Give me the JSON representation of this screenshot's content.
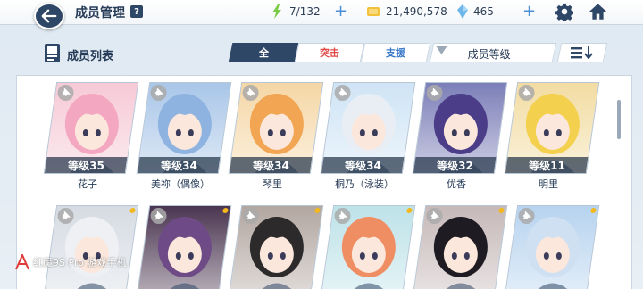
{
  "header": {
    "title": "成员管理",
    "help_label": "?",
    "stamina": "7/132",
    "credits": "21,490,578",
    "gems": "465"
  },
  "list": {
    "title": "成员列表",
    "tabs": [
      "全",
      "突击",
      "支援"
    ],
    "sort_label": "成员等级"
  },
  "members": [
    {
      "name": "花子",
      "level": "等级35",
      "bg": "#f6c9d6",
      "hair": "#f4a7c0"
    },
    {
      "name": "美祢（偶像）",
      "level": "等级34",
      "bg": "#a9c6e8",
      "hair": "#8fb3e0"
    },
    {
      "name": "琴里",
      "level": "等级34",
      "bg": "#f5d7a6",
      "hair": "#f2a552"
    },
    {
      "name": "桐乃（泳装）",
      "level": "等级34",
      "bg": "#cfe4f5",
      "hair": "#e9eef5"
    },
    {
      "name": "优香",
      "level": "等级32",
      "bg": "#7c7fb8",
      "hair": "#4b3d88"
    },
    {
      "name": "明里",
      "level": "等级11",
      "bg": "#f2dca2",
      "hair": "#f3d04e"
    },
    {
      "name": "",
      "level": "",
      "bg": "#d6dbe3",
      "hair": "#eef0f4"
    },
    {
      "name": "",
      "level": "",
      "bg": "#4a3550",
      "hair": "#6e4a87"
    },
    {
      "name": "",
      "level": "",
      "bg": "#b2a6a0",
      "hair": "#2c2a2b"
    },
    {
      "name": "",
      "level": "",
      "bg": "#bde2e8",
      "hair": "#f08e63"
    },
    {
      "name": "",
      "level": "",
      "bg": "#c6b8b8",
      "hair": "#1e1c22"
    },
    {
      "name": "",
      "level": "",
      "bg": "#b7d3ef",
      "hair": "#cfe0f3"
    }
  ],
  "watermark": "红魔9S Pro 游戏手机",
  "colors": {
    "navy": "#2f4766",
    "accent_blue": "#4a8fd6",
    "assault": "#e04848",
    "support": "#3a79c9"
  }
}
